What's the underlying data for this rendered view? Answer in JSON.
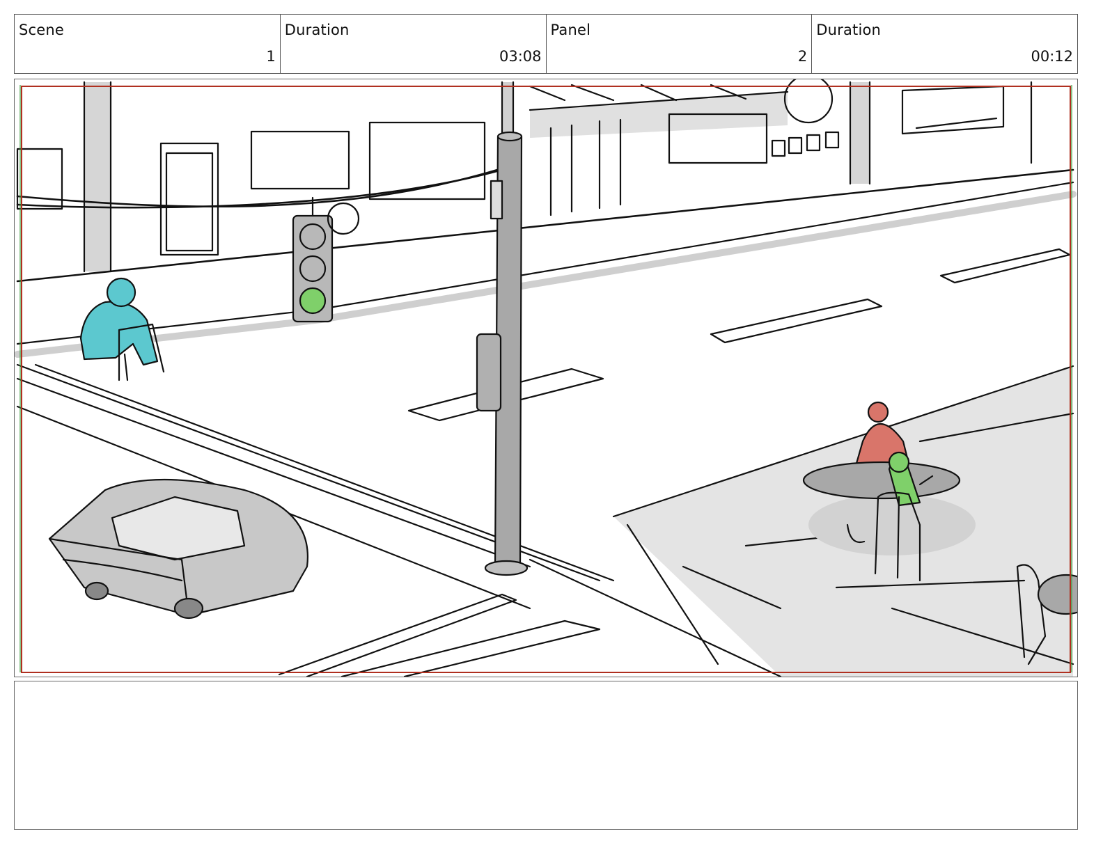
{
  "header": {
    "scene_label": "Scene",
    "scene_value": "1",
    "scene_duration_label": "Duration",
    "scene_duration_value": "03:08",
    "panel_label": "Panel",
    "panel_value": "2",
    "panel_duration_label": "Duration",
    "panel_duration_value": "00:12"
  },
  "colors": {
    "safe_frame_red": "#b03020",
    "safe_frame_green": "#3a9a3a",
    "sketch_line": "#111111",
    "tone_gray": "#c8c8c8",
    "light_gray": "#e2e2e2",
    "character_cyan": "#5cc8cf",
    "character_red": "#d9756a",
    "character_green": "#7fd06a"
  },
  "notes": {
    "text": ""
  }
}
